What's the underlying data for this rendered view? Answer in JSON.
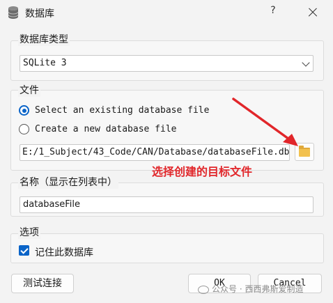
{
  "window": {
    "title": "数据库",
    "help_label": "?",
    "icon": "database-icon"
  },
  "type_group": {
    "legend": "数据库类型",
    "selected": "SQLite 3"
  },
  "file_group": {
    "legend": "文件",
    "option_existing": "Select an existing database file",
    "option_new": "Create a new database file",
    "selected_option": "existing",
    "path": "E:/1_Subject/43_Code/CAN/Database/databaseFile.db",
    "browse_icon": "folder-icon"
  },
  "annotation": {
    "text": "选择创建的目标文件",
    "color": "#e1262a"
  },
  "name_group": {
    "legend": "名称（显示在列表中）",
    "value": "databaseFile"
  },
  "options_group": {
    "legend": "选项",
    "remember_label": "记住此数据库",
    "remember_checked": true
  },
  "buttons": {
    "test": "测试连接",
    "ok": "OK",
    "cancel": "Cancel"
  },
  "watermark": {
    "text": "公众号 · 西西弗斯爱制造"
  },
  "colors": {
    "accent": "#0a64c8",
    "annotation": "#e1262a"
  }
}
